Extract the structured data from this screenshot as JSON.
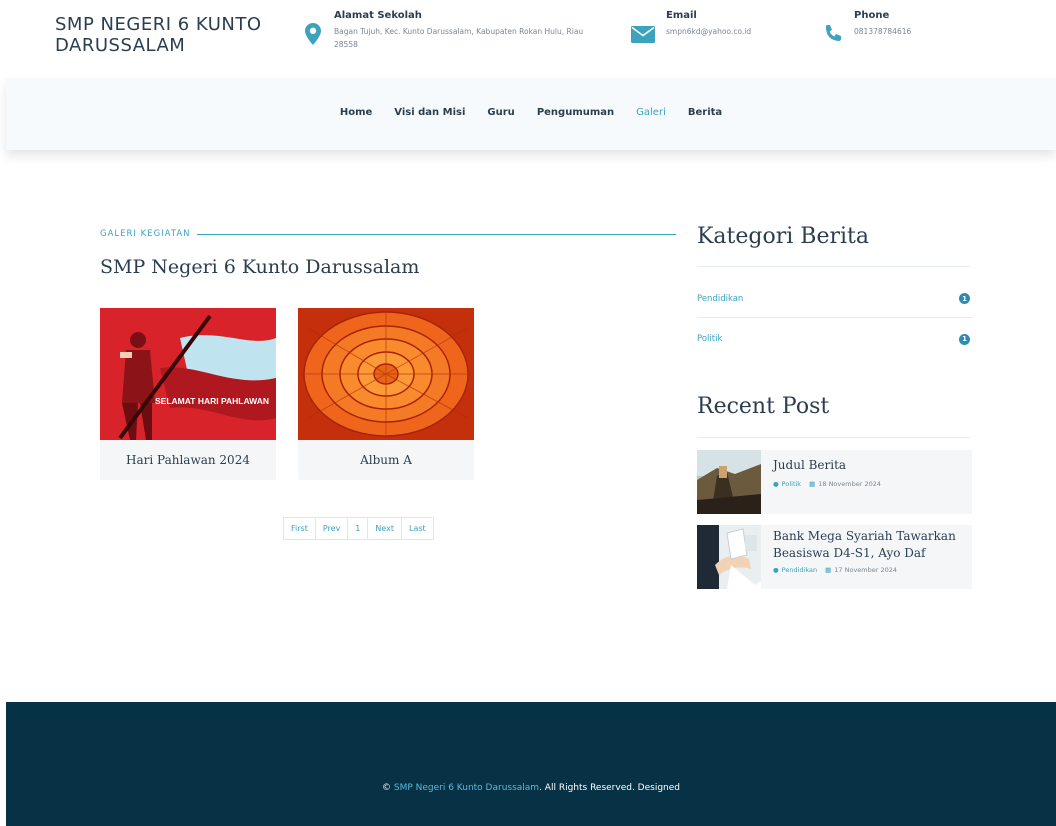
{
  "header": {
    "brand": "SMP NEGERI 6 KUNTO DARUSSALAM",
    "address": {
      "title": "Alamat Sekolah",
      "value": "Bagan Tujuh, Kec. Kunto Darussalam, Kabupaten Rokan Hulu, Riau 28558"
    },
    "email": {
      "title": "Email",
      "value": "smpn6kd@yahoo.co.id"
    },
    "phone": {
      "title": "Phone",
      "value": "081378784616"
    }
  },
  "nav": {
    "items": [
      {
        "label": "Home"
      },
      {
        "label": "Visi dan Misi"
      },
      {
        "label": "Guru"
      },
      {
        "label": "Pengumuman"
      },
      {
        "label": "Galeri"
      },
      {
        "label": "Berita"
      }
    ],
    "active": "Galeri"
  },
  "main": {
    "section_label": "GALERI KEGIATAN",
    "heading": "SMP Negeri 6 Kunto Darussalam",
    "albums": [
      {
        "caption": "Hari Pahlawan 2024",
        "image_text": "SELAMAT HARI PAHLAWAN"
      },
      {
        "caption": "Album A"
      }
    ],
    "pager": {
      "first": "First",
      "prev": "Prev",
      "current": "1",
      "next": "Next",
      "last": "Last"
    }
  },
  "sidebar": {
    "categories_title": "Kategori Berita",
    "categories": [
      {
        "name": "Pendidikan",
        "count": "1"
      },
      {
        "name": "Politik",
        "count": "1"
      }
    ],
    "recent_title": "Recent Post",
    "posts": [
      {
        "title": "Judul Berita",
        "category": "Politik",
        "date": "18 November 2024"
      },
      {
        "title": "Bank Mega Syariah Tawarkan Beasiswa D4-S1, Ayo Daf",
        "category": "Pendidikan",
        "date": "17 November 2024"
      }
    ]
  },
  "footer": {
    "copyright_symbol": "©",
    "site_name": "SMP Negeri 6 Kunto Darussalam",
    "rest": ". All Rights Reserved. Designed"
  },
  "colors": {
    "accent": "#3ca3bf",
    "dark": "#2b3e50",
    "footer_bg": "#073246"
  }
}
